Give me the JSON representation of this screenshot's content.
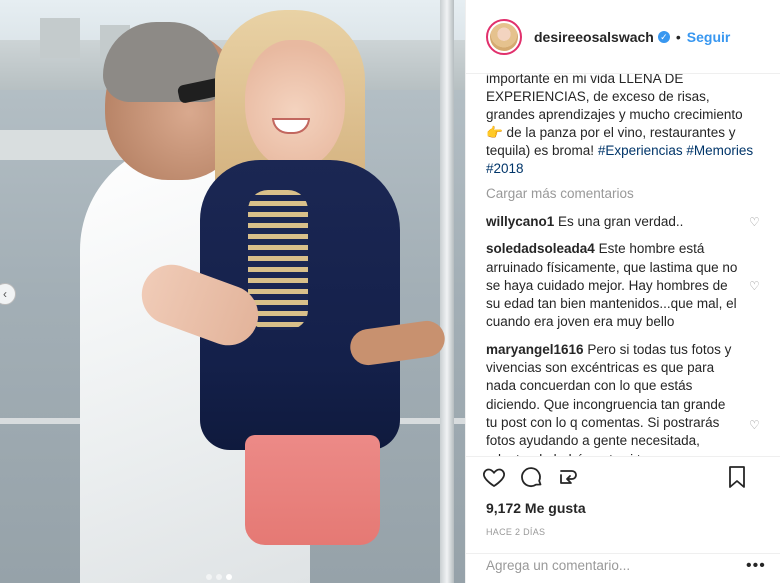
{
  "post": {
    "username": "desireeosalswach",
    "follow_label": "Seguir",
    "separator": "•",
    "caption_text": "importante en mi vida LLENA DE EXPERIENCIAS, de exceso de risas, grandes aprendizajes y mucho crecimiento 👉 de la panza por el vino, restaurantes y tequila) es broma! ",
    "hashtags": "#Experiencias #Memories #2018",
    "load_more": "Cargar más comentarios",
    "likes": "9,172 Me gusta",
    "date": "HACE 2 DÍAS",
    "comment_placeholder": "Agrega un comentario...",
    "more": "•••"
  },
  "comments": [
    {
      "user": "willycano1",
      "text": "Es una gran verdad.."
    },
    {
      "user": "soledadsoleada4",
      "text": "Este hombre está arruinado físicamente, que lastima que no se haya cuidado mejor. Hay hombres de su edad tan bien mantenidos...que mal, el cuando era joven era muy bello"
    },
    {
      "user": "maryangel1616",
      "text": "Pero si todas tus fotos y vivencias son excéntricas es que para nada concuerdan con lo que estás diciendo. Que incongruencia tan grande tu post con lo q comentas. Si postrarás fotos ayudando a gente necesitada, adoptando bebés , etc si te"
    }
  ],
  "icons": {
    "verified": "verified-badge-icon",
    "heart": "heart-icon",
    "comment": "comment-icon",
    "share": "share-icon",
    "bookmark": "bookmark-icon",
    "prev": "chevron-left-icon"
  },
  "colors": {
    "accent": "#3897f0",
    "hashtag": "#003569",
    "muted": "#999999"
  },
  "carousel": {
    "count": 3,
    "active": 2
  }
}
